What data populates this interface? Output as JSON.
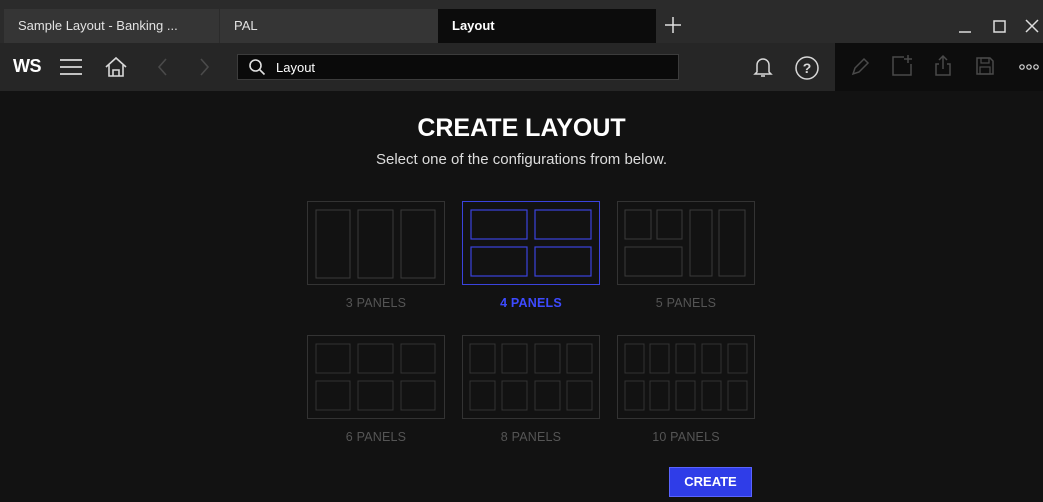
{
  "tabs": [
    {
      "label": "Sample Layout - Banking ..."
    },
    {
      "label": "PAL"
    },
    {
      "label": "Layout"
    }
  ],
  "toolbar": {
    "logo": "WS",
    "search": {
      "value": "Layout"
    }
  },
  "main": {
    "title": "CREATE LAYOUT",
    "subtitle": "Select one of the configurations from below.",
    "options": [
      {
        "label": "3 PANELS",
        "panels": 3,
        "selected": false
      },
      {
        "label": "4 PANELS",
        "panels": 4,
        "selected": true
      },
      {
        "label": "5 PANELS",
        "panels": 5,
        "selected": false
      },
      {
        "label": "6 PANELS",
        "panels": 6,
        "selected": false
      },
      {
        "label": "8 PANELS",
        "panels": 8,
        "selected": false
      },
      {
        "label": "10 PANELS",
        "panels": 10,
        "selected": false
      }
    ],
    "create_label": "CREATE"
  },
  "colors": {
    "accent": "#2f3de8",
    "selected_border": "#3a43dd",
    "selected_label": "#3d4aff",
    "inactive": "#555555"
  }
}
